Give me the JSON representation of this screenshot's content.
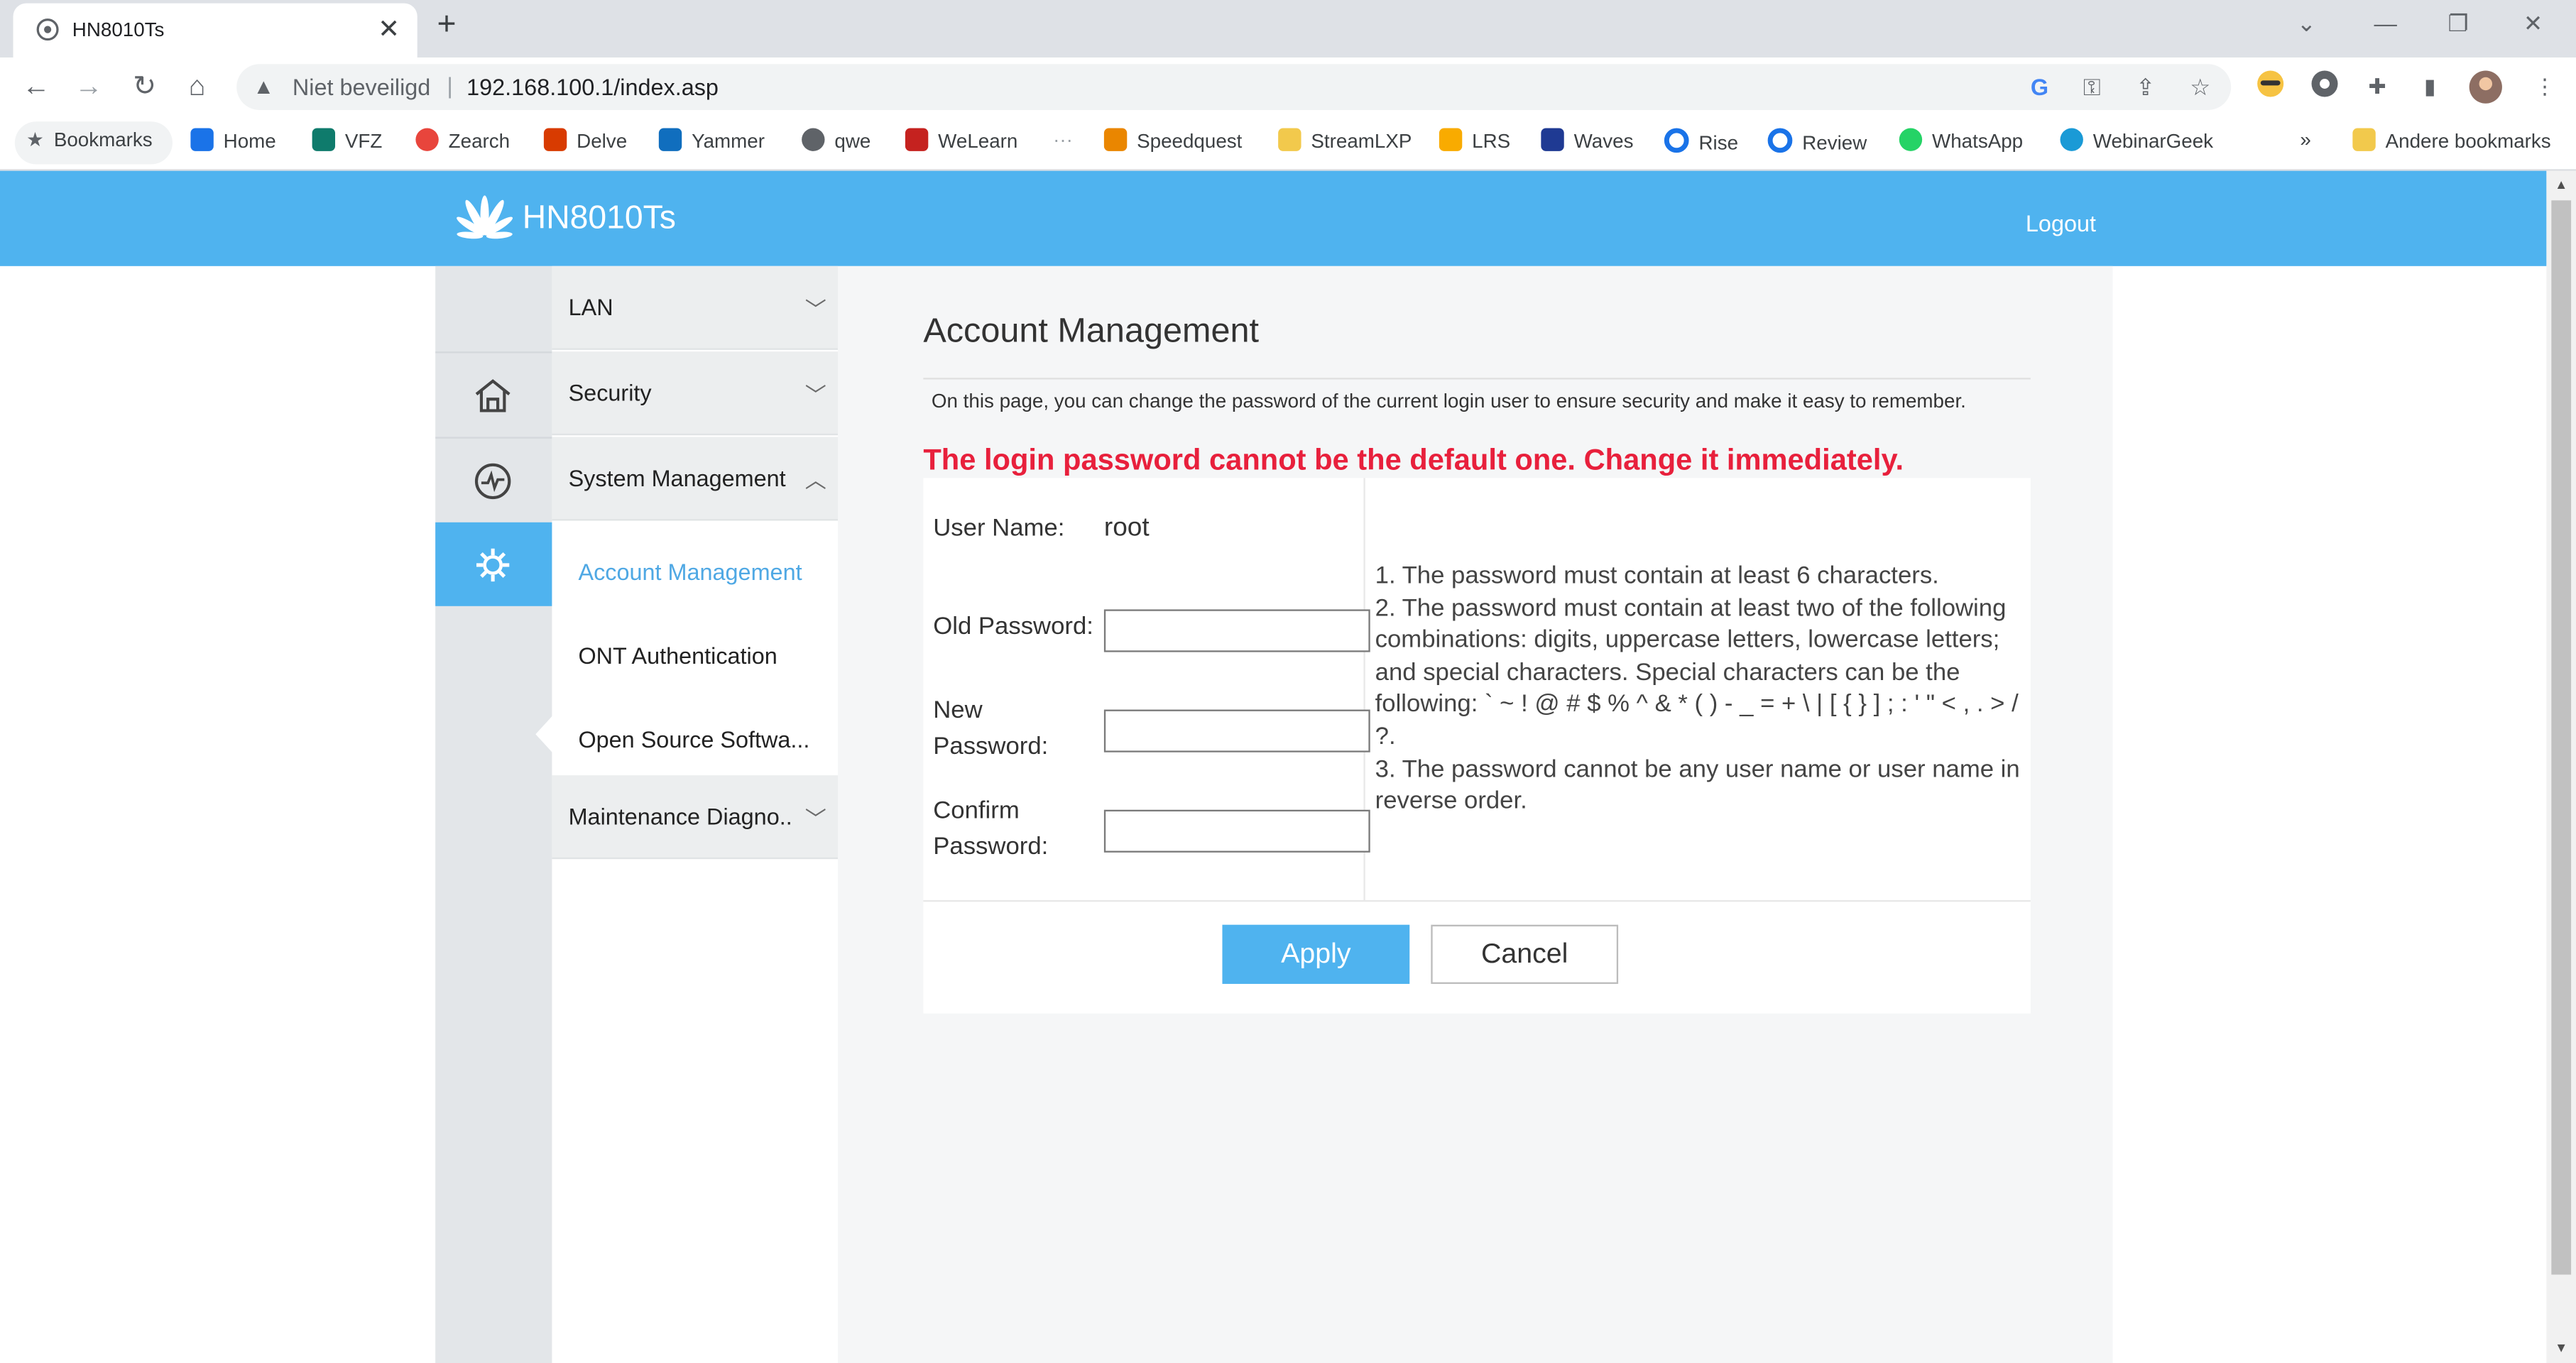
{
  "browser": {
    "tab_title": "HN8010Ts",
    "security_label": "Niet beveiligd",
    "url": "192.168.100.1/index.asp",
    "bookmarks": [
      {
        "label": "Bookmarks",
        "color": "#5f6368"
      },
      {
        "label": "Home",
        "color": "#1a73e8"
      },
      {
        "label": "VFZ",
        "color": "#0f7b6c"
      },
      {
        "label": "Zearch",
        "color": "#e8453c"
      },
      {
        "label": "Delve",
        "color": "#d83b01"
      },
      {
        "label": "Yammer",
        "color": "#106ebe"
      },
      {
        "label": "qwe",
        "color": "#5f6368"
      },
      {
        "label": "WeLearn",
        "color": "#c5221f"
      },
      {
        "label": "Speedquest",
        "color": "#ea8600"
      },
      {
        "label": "StreamLXP",
        "color": "#f2c94c"
      },
      {
        "label": "LRS",
        "color": "#f9ab00"
      },
      {
        "label": "Waves",
        "color": "#1f3a93"
      },
      {
        "label": "Rise",
        "color": "#1a73e8"
      },
      {
        "label": "Review",
        "color": "#1a73e8"
      },
      {
        "label": "WhatsApp",
        "color": "#25d366"
      },
      {
        "label": "WebinarGeek",
        "color": "#1a9ad6"
      }
    ],
    "other_bookmarks": "Andere bookmarks"
  },
  "header": {
    "brand": "HN8010Ts",
    "logout": "Logout",
    "brand_color": "#4fb3ef"
  },
  "menu": {
    "groups": [
      {
        "label": "LAN",
        "state": "collapsed"
      },
      {
        "label": "Security",
        "state": "collapsed"
      },
      {
        "label": "System Management",
        "state": "expanded"
      },
      {
        "label": "Maintenance Diagno..",
        "state": "collapsed"
      }
    ],
    "sub_items": [
      {
        "label": "Account Management",
        "active": true
      },
      {
        "label": "ONT Authentication",
        "active": false
      },
      {
        "label": "Open Source Softwa...",
        "active": false
      }
    ],
    "icons": [
      "home-icon",
      "status-icon",
      "settings-gear-icon"
    ]
  },
  "page": {
    "title": "Account Management",
    "description": "On this page, you can change the password of the current login user to ensure security and make it easy to remember.",
    "alert": "The login password cannot be the default one. Change it immediately.",
    "alert_color": "#e8203c",
    "form": {
      "username_label": "User Name:",
      "username_value": "root",
      "old_password_label": "Old Password:",
      "new_password_label": "New Password:",
      "confirm_password_label": "Confirm Password:",
      "old_password_value": "",
      "new_password_value": "",
      "confirm_password_value": ""
    },
    "rules": [
      "1. The password must contain at least 6 characters.",
      "2. The password must contain at least two of the following combinations: digits, uppercase letters, lowercase letters; and special characters. Special characters can be the following: ` ~ ! @ # $ % ^ & * ( ) - _ = + \\ | [ { } ] ; : ' \" < , . > / ?.",
      "3. The password cannot be any user name or user name in reverse order."
    ],
    "apply_label": "Apply",
    "cancel_label": "Cancel"
  }
}
